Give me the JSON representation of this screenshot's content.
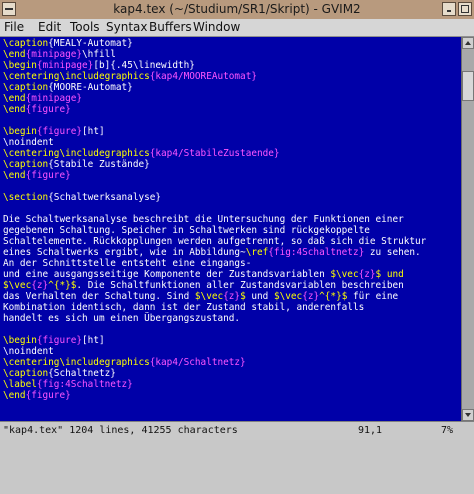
{
  "window": {
    "title": "kap4.tex (~/Studium/SR1/Skript) - GVIM2"
  },
  "menu": [
    "File",
    "Edit",
    "Tools",
    "Syntax",
    "Buffers",
    "Window"
  ],
  "editor": {
    "lines": [
      [
        {
          "t": "\\caption",
          "c": "kw"
        },
        {
          "t": "{MEALY-Automat}",
          "c": "txt"
        }
      ],
      [
        {
          "t": "\\end",
          "c": "kw"
        },
        {
          "t": "{minipage}",
          "c": "arg"
        },
        {
          "t": "\\hfill",
          "c": "txt"
        }
      ],
      [
        {
          "t": "\\begin",
          "c": "kw"
        },
        {
          "t": "{minipage}",
          "c": "arg"
        },
        {
          "t": "[b]{.45\\linewidth}",
          "c": "txt"
        }
      ],
      [
        {
          "t": "\\centering\\includegraphics",
          "c": "kw"
        },
        {
          "t": "{kap4/MOOREAutomat}",
          "c": "arg"
        }
      ],
      [
        {
          "t": "\\caption",
          "c": "kw"
        },
        {
          "t": "{MOORE-Automat}",
          "c": "txt"
        }
      ],
      [
        {
          "t": "\\end",
          "c": "kw"
        },
        {
          "t": "{minipage}",
          "c": "arg"
        }
      ],
      [
        {
          "t": "\\end",
          "c": "kw"
        },
        {
          "t": "{figure}",
          "c": "arg"
        }
      ],
      [],
      [
        {
          "t": "\\begin",
          "c": "kw"
        },
        {
          "t": "{figure}",
          "c": "arg"
        },
        {
          "t": "[ht]",
          "c": "txt"
        }
      ],
      [
        {
          "t": "\\noindent",
          "c": "txt"
        }
      ],
      [
        {
          "t": "\\centering\\includegraphics",
          "c": "kw"
        },
        {
          "t": "{kap4/StabileZustaende}",
          "c": "arg"
        }
      ],
      [
        {
          "t": "\\caption",
          "c": "kw"
        },
        {
          "t": "{Stabile Zustände}",
          "c": "txt"
        }
      ],
      [
        {
          "t": "\\end",
          "c": "kw"
        },
        {
          "t": "{figure}",
          "c": "arg"
        }
      ],
      [],
      [
        {
          "t": "\\section",
          "c": "kw"
        },
        {
          "t": "{Schaltwerksanalyse}",
          "c": "txt"
        }
      ],
      [],
      [
        {
          "t": "Die Schaltwerksanalyse beschreibt die Untersuchung der Funktionen einer",
          "c": "txt"
        }
      ],
      [
        {
          "t": "gegebenen Schaltung. Speicher in Schaltwerken sind rückgekoppelte",
          "c": "txt"
        }
      ],
      [
        {
          "t": "Schaltelemente. Rückkopplungen werden aufgetrennt, so daß sich die Struktur",
          "c": "txt"
        }
      ],
      [
        {
          "t": "eines Schaltwerks ergibt, wie in Abbildung~",
          "c": "txt"
        },
        {
          "t": "\\ref",
          "c": "kw"
        },
        {
          "t": "{fig:4Schaltnetz}",
          "c": "arg"
        },
        {
          "t": " zu sehen.",
          "c": "txt"
        }
      ],
      [
        {
          "t": "An der Schnittstelle entsteht eine eingangs-",
          "c": "txt"
        }
      ],
      [
        {
          "t": "und eine ausgangsseitige Komponente der Zustandsvariablen ",
          "c": "txt"
        },
        {
          "t": "$\\vec",
          "c": "kw"
        },
        {
          "t": "{z}",
          "c": "arg"
        },
        {
          "t": "$ und",
          "c": "kw"
        }
      ],
      [
        {
          "t": "$\\vec",
          "c": "kw"
        },
        {
          "t": "{z}",
          "c": "arg"
        },
        {
          "t": "^{*}$",
          "c": "kw"
        },
        {
          "t": ". Die Schaltfunktionen aller Zustandsvariablen beschreiben",
          "c": "txt"
        }
      ],
      [
        {
          "t": "das Verhalten der Schaltung. Sind ",
          "c": "txt"
        },
        {
          "t": "$\\vec",
          "c": "kw"
        },
        {
          "t": "{z}",
          "c": "arg"
        },
        {
          "t": "$",
          "c": "kw"
        },
        {
          "t": " und ",
          "c": "txt"
        },
        {
          "t": "$\\vec",
          "c": "kw"
        },
        {
          "t": "{z}",
          "c": "arg"
        },
        {
          "t": "^{*}$",
          "c": "kw"
        },
        {
          "t": " für eine",
          "c": "txt"
        }
      ],
      [
        {
          "t": "Kombination identisch, dann ist der Zustand stabil, anderenfalls",
          "c": "txt"
        }
      ],
      [
        {
          "t": "handelt es sich um einen Übergangszustand.",
          "c": "txt"
        }
      ],
      [],
      [
        {
          "t": "\\begin",
          "c": "kw"
        },
        {
          "t": "{figure}",
          "c": "arg"
        },
        {
          "t": "[ht]",
          "c": "txt"
        }
      ],
      [
        {
          "t": "\\noindent",
          "c": "txt"
        }
      ],
      [
        {
          "t": "\\centering\\includegraphics",
          "c": "kw"
        },
        {
          "t": "{kap4/Schaltnetz}",
          "c": "arg"
        }
      ],
      [
        {
          "t": "\\caption",
          "c": "kw"
        },
        {
          "t": "{Schaltnetz}",
          "c": "txt"
        }
      ],
      [
        {
          "t": "\\label",
          "c": "kw"
        },
        {
          "t": "{fig:4Schaltnetz}",
          "c": "arg"
        }
      ],
      [
        {
          "t": "\\end",
          "c": "kw"
        },
        {
          "t": "{figure}",
          "c": "arg"
        }
      ]
    ]
  },
  "status": {
    "file_info": "\"kap4.tex\" 1204 lines, 41255 characters",
    "position": "91,1",
    "percent": "7%"
  },
  "colors": {
    "background": "#0000a8",
    "keyword": "#ffff00",
    "argument": "#ff55ff",
    "text": "#ffffff"
  }
}
